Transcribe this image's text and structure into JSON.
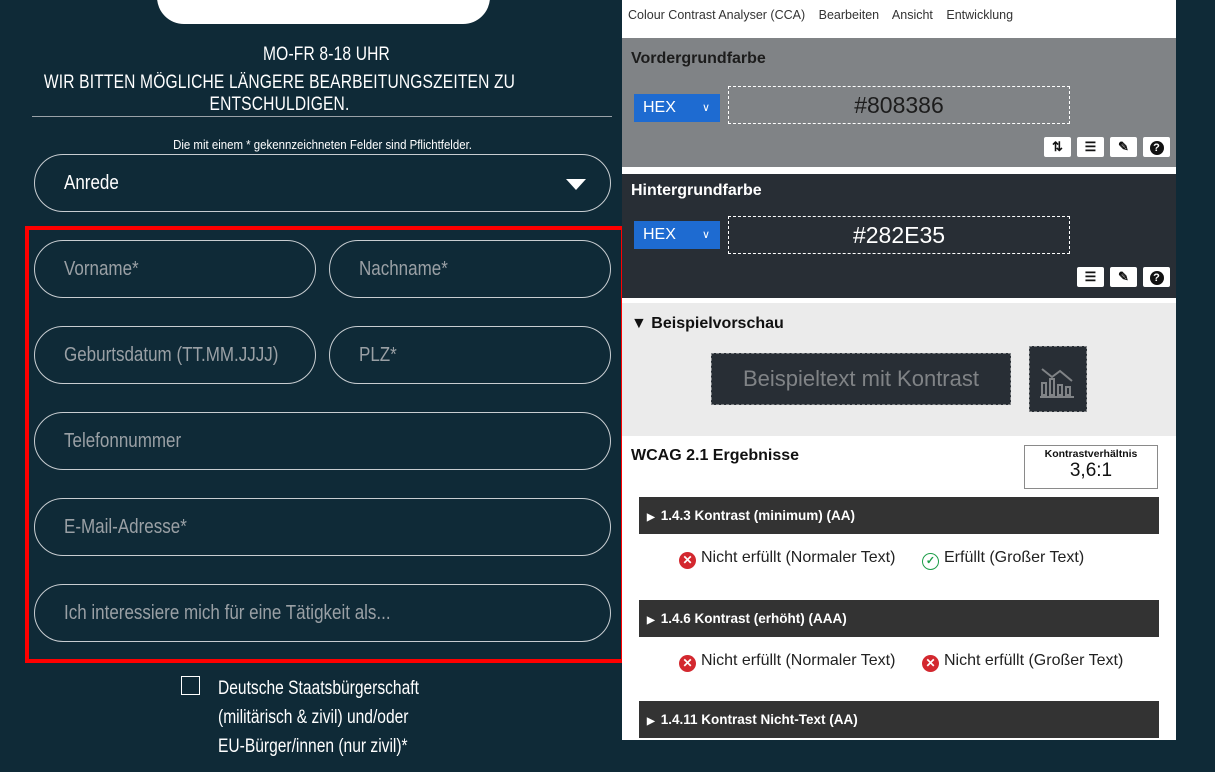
{
  "form": {
    "hours_line1": "MO-FR 8-18 UHR",
    "hours_line2": "WIR BITTEN MÖGLICHE LÄNGERE BEARBEITUNGSZEITEN ZU ENTSCHULDIGEN.",
    "required_note": "Die mit einem * gekennzeichneten Felder sind Pflichtfelder.",
    "salutation": "Anrede",
    "fields": {
      "first_name": "Vorname*",
      "last_name": "Nachname*",
      "birthdate": "Geburtsdatum (TT.MM.JJJJ)",
      "zip": "PLZ*",
      "phone": "Telefonnummer",
      "email": "E-Mail-Adresse*",
      "interest": "Ich interessiere mich für eine Tätigkeit als..."
    },
    "citizenship_line1": "Deutsche Staatsbürgerschaft",
    "citizenship_line2": "(militärisch & zivil) und/oder",
    "citizenship_line3": "EU-Bürger/innen (nur zivil)*",
    "highlight_color": "#ff0000"
  },
  "cca": {
    "menu": [
      "Colour Contrast Analyser (CCA)",
      "Bearbeiten",
      "Ansicht",
      "Entwicklung"
    ],
    "foreground": {
      "title": "Vordergrundfarbe",
      "format": "HEX",
      "value": "#808386",
      "tools": [
        "swap-icon",
        "sliders-icon",
        "eyedropper-icon",
        "help-icon"
      ]
    },
    "background": {
      "title": "Hintergrundfarbe",
      "format": "HEX",
      "value": "#282E35",
      "tools": [
        "sliders-icon",
        "eyedropper-icon",
        "help-icon"
      ]
    },
    "preview": {
      "title": "Beispielvorschau",
      "sample_text": "Beispieltext mit Kontrast"
    },
    "wcag": {
      "title": "WCAG 2.1 Ergebnisse",
      "ratio_label": "Kontrastverhältnis",
      "ratio_value": "3,6:1",
      "criteria": [
        {
          "label": "1.4.3 Kontrast (minimum) (AA)",
          "normal": "Nicht erfüllt (Normaler Text)",
          "normal_status": "fail",
          "large": "Erfüllt (Großer Text)",
          "large_status": "pass"
        },
        {
          "label": "1.4.6 Kontrast (erhöht) (AAA)",
          "normal": "Nicht erfüllt (Normaler Text)",
          "normal_status": "fail",
          "large": "Nicht erfüllt (Großer Text)",
          "large_status": "fail"
        },
        {
          "label": "1.4.11 Kontrast Nicht-Text (AA)"
        }
      ]
    },
    "colors": {
      "fg_panel": "#808386",
      "bg_panel": "#282e35",
      "accent": "#1e6bd1",
      "fail": "#d3282f",
      "pass": "#1e9e4a"
    }
  }
}
